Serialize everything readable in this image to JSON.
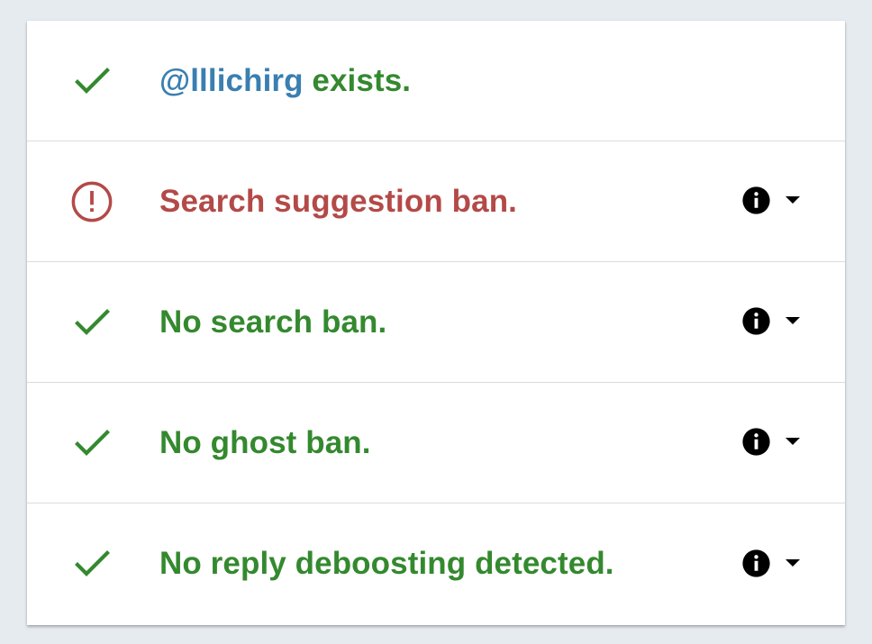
{
  "colors": {
    "ok": "#34892f",
    "error": "#b34a48",
    "handle": "#3a7fb0",
    "icon": "#000000"
  },
  "rows": [
    {
      "status_icon": "checkmark-icon",
      "handle": "@lllichirg",
      "text": " exists.",
      "has_details": false
    },
    {
      "status_icon": "alert-circle-icon",
      "text": "Search suggestion ban.",
      "has_details": true,
      "info_icon": "info-icon",
      "dropdown_icon": "caret-down-icon"
    },
    {
      "status_icon": "checkmark-icon",
      "text": "No search ban.",
      "has_details": true,
      "info_icon": "info-icon",
      "dropdown_icon": "caret-down-icon"
    },
    {
      "status_icon": "checkmark-icon",
      "text": "No ghost ban.",
      "has_details": true,
      "info_icon": "info-icon",
      "dropdown_icon": "caret-down-icon"
    },
    {
      "status_icon": "checkmark-icon",
      "text": "No reply deboosting detected.",
      "has_details": true,
      "info_icon": "info-icon",
      "dropdown_icon": "caret-down-icon"
    }
  ]
}
